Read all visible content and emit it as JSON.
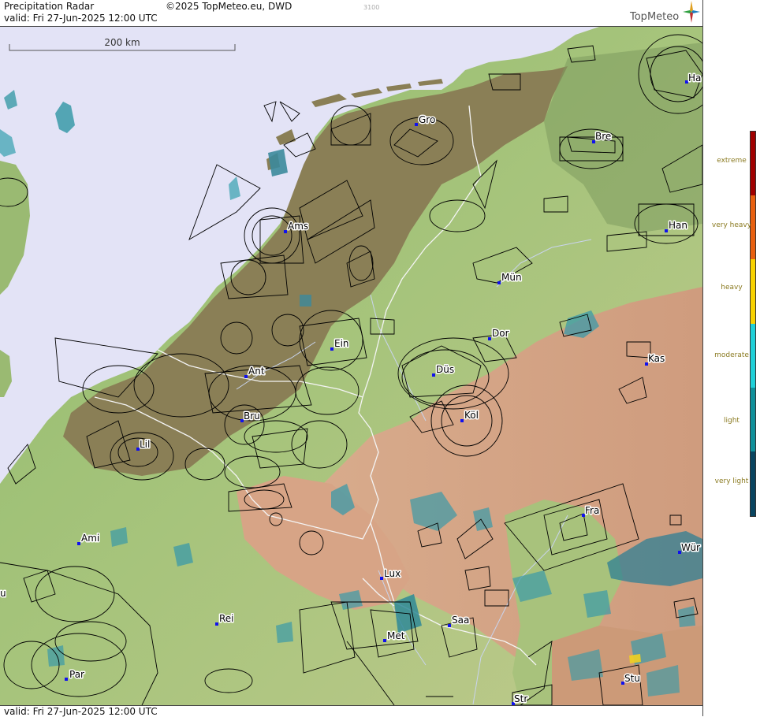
{
  "header": {
    "title": "Precipitation Radar",
    "copyright": "©2025 TopMeteo.eu, DWD",
    "valid": "valid:  Fri  27-Jun-2025 12:00 UTC",
    "code": "3100",
    "brand": "TopMeteo"
  },
  "scale": {
    "label": "200 km"
  },
  "footer": {
    "valid": "valid:  Fri  27-Jun-2025 12:00 UTC"
  },
  "legend": {
    "items": [
      {
        "label": "extreme",
        "color": "#a00000"
      },
      {
        "label": "very heavy",
        "color": "#e86010"
      },
      {
        "label": "heavy",
        "color": "#f8d200"
      },
      {
        "label": "moderate",
        "color": "#20d0d8"
      },
      {
        "label": "light",
        "color": "#10909a"
      },
      {
        "label": "very light",
        "color": "#0a4560"
      }
    ]
  },
  "cities": [
    {
      "name": "Gro"
    },
    {
      "name": "Ha"
    },
    {
      "name": "Bre"
    },
    {
      "name": "Ams"
    },
    {
      "name": "Han"
    },
    {
      "name": "Mün"
    },
    {
      "name": "Ein"
    },
    {
      "name": "Dor"
    },
    {
      "name": "Kas"
    },
    {
      "name": "Ant"
    },
    {
      "name": "Düs"
    },
    {
      "name": "Bru"
    },
    {
      "name": "Köl"
    },
    {
      "name": "Lil"
    },
    {
      "name": "Fra"
    },
    {
      "name": "Ami"
    },
    {
      "name": "Wür"
    },
    {
      "name": "Lux"
    },
    {
      "name": "Rei"
    },
    {
      "name": "Saa"
    },
    {
      "name": "Met"
    },
    {
      "name": "Par"
    },
    {
      "name": "Stu"
    },
    {
      "name": "Str"
    },
    {
      "name": "u"
    }
  ],
  "colors": {
    "sea": "#e2e2f6",
    "lowland": "#8a7f55",
    "plain": "#8fba6e",
    "hills": "#d4a184",
    "airspace": "#000000",
    "border": "#ffffff"
  }
}
